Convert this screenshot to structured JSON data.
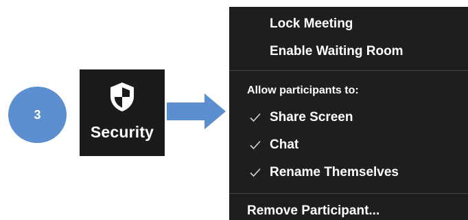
{
  "step": {
    "number": "3",
    "color": "#5b8fd0"
  },
  "security_button": {
    "label": "Security",
    "icon": "shield-icon",
    "background": "#1b1b1b"
  },
  "arrow": {
    "icon": "right-arrow-icon",
    "color": "#5b8fd0"
  },
  "menu": {
    "background": "#1e1e1e",
    "lock_meeting": "Lock Meeting",
    "enable_waiting_room": "Enable Waiting Room",
    "allow_section_label": "Allow participants to:",
    "options": [
      {
        "label": "Share Screen",
        "checked": true
      },
      {
        "label": "Chat",
        "checked": true
      },
      {
        "label": "Rename Themselves",
        "checked": true
      }
    ],
    "remove_participant": "Remove Participant..."
  }
}
